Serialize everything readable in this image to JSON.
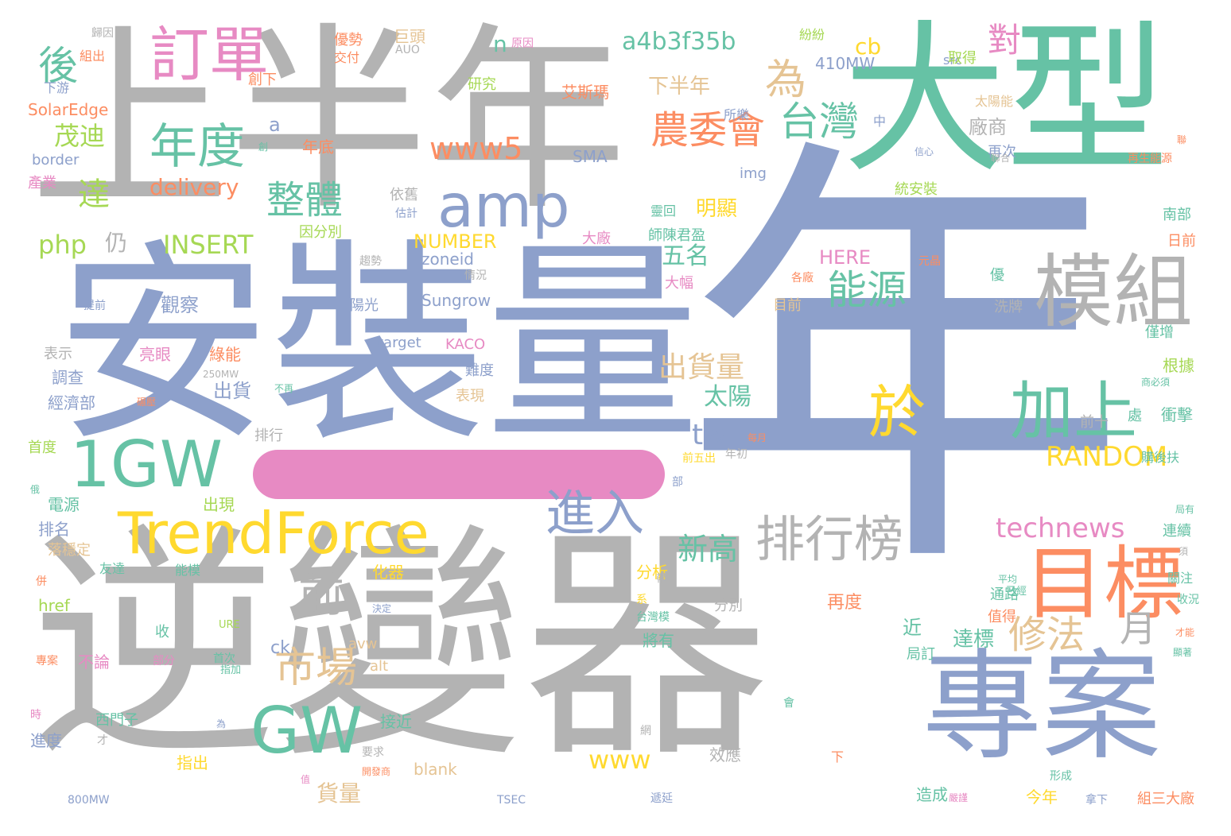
{
  "colors": {
    "gray": "#b3b3b3",
    "blue": "#8da0cb",
    "green": "#66c2a5",
    "pink": "#e78ac3",
    "orange": "#fc8d62",
    "yellow": "#ffd92f",
    "tan": "#e5c494",
    "lime": "#a6d854"
  },
  "bar_color": "#e78ac3",
  "words": [
    {
      "text": "年",
      "color": "blue"
    },
    {
      "text": "逆變器",
      "color": "gray"
    },
    {
      "text": "安裝量",
      "color": "blue"
    },
    {
      "text": "上半年",
      "color": "gray"
    },
    {
      "text": "大型",
      "color": "green"
    },
    {
      "text": "專案",
      "color": "blue"
    },
    {
      "text": "目標",
      "color": "orange"
    },
    {
      "text": "模組",
      "color": "gray"
    },
    {
      "text": "訂單",
      "color": "pink"
    },
    {
      "text": "1GW",
      "color": "green"
    },
    {
      "text": "TrendForce",
      "color": "yellow"
    },
    {
      "text": "amp",
      "color": "blue"
    },
    {
      "text": "加上",
      "color": "green"
    },
    {
      "text": "於",
      "color": "yellow"
    },
    {
      "text": "年度",
      "color": "green"
    },
    {
      "text": "GW",
      "color": "green"
    },
    {
      "text": "排行榜",
      "color": "gray"
    },
    {
      "text": "進入",
      "color": "blue"
    },
    {
      "text": "前",
      "color": "gray"
    },
    {
      "text": "市場",
      "color": "tan"
    },
    {
      "text": "修法",
      "color": "tan"
    },
    {
      "text": "月",
      "color": "gray"
    },
    {
      "text": "能源",
      "color": "green"
    },
    {
      "text": "台灣",
      "color": "green"
    },
    {
      "text": "農委會",
      "color": "orange"
    },
    {
      "text": "整體",
      "color": "green"
    },
    {
      "text": "為",
      "color": "tan"
    },
    {
      "text": "後",
      "color": "green"
    },
    {
      "text": "對",
      "color": "pink"
    },
    {
      "text": "www5",
      "color": "orange"
    },
    {
      "text": "a4b3f35b",
      "color": "green"
    },
    {
      "text": "technews",
      "color": "pink"
    },
    {
      "text": "RANDOM",
      "color": "yellow"
    },
    {
      "text": "出貨量",
      "color": "tan"
    },
    {
      "text": "新高",
      "color": "green"
    },
    {
      "text": "www",
      "color": "yellow"
    },
    {
      "text": "INSERT",
      "color": "lime"
    },
    {
      "text": "php",
      "color": "lime"
    },
    {
      "text": "仍",
      "color": "gray"
    },
    {
      "text": "delivery",
      "color": "orange"
    },
    {
      "text": "達",
      "color": "lime"
    },
    {
      "text": "茂迪",
      "color": "lime"
    },
    {
      "text": "NUMBER",
      "color": "yellow"
    },
    {
      "text": "tw",
      "color": "blue"
    },
    {
      "text": "太陽",
      "color": "green"
    },
    {
      "text": "五名",
      "color": "green"
    },
    {
      "text": "明顯",
      "color": "yellow"
    },
    {
      "text": "下半年",
      "color": "tan"
    },
    {
      "text": "cb",
      "color": "yellow"
    },
    {
      "text": "n",
      "color": "green"
    },
    {
      "text": "a",
      "color": "blue"
    },
    {
      "text": "廠商",
      "color": "gray"
    },
    {
      "text": "出貨",
      "color": "blue"
    },
    {
      "text": "貨量",
      "color": "tan"
    },
    {
      "text": "達標",
      "color": "green"
    },
    {
      "text": "近",
      "color": "green"
    },
    {
      "text": "觀察",
      "color": "blue"
    },
    {
      "text": "HERE",
      "color": "pink"
    },
    {
      "text": "Sungrow",
      "color": "blue"
    },
    {
      "text": "zoneid",
      "color": "blue"
    },
    {
      "text": "410MW",
      "color": "blue"
    },
    {
      "text": "SolarEdge",
      "color": "orange"
    },
    {
      "text": "KACO",
      "color": "pink"
    },
    {
      "text": "target",
      "color": "blue"
    },
    {
      "text": "SMA",
      "color": "blue"
    },
    {
      "text": "href",
      "color": "lime"
    },
    {
      "text": "blank",
      "color": "tan"
    },
    {
      "text": "avw",
      "color": "tan"
    },
    {
      "text": "alt",
      "color": "tan"
    },
    {
      "text": "ck",
      "color": "blue"
    },
    {
      "text": "img",
      "color": "blue"
    },
    {
      "text": "src",
      "color": "blue"
    },
    {
      "text": "border",
      "color": "blue"
    },
    {
      "text": "AUO",
      "color": "gray"
    },
    {
      "text": "TSEC",
      "color": "blue"
    },
    {
      "text": "800MW",
      "color": "blue"
    },
    {
      "text": "250MW",
      "color": "gray"
    },
    {
      "text": "URE",
      "color": "lime"
    },
    {
      "text": "艾斯瑪",
      "color": "orange"
    },
    {
      "text": "研究",
      "color": "lime"
    },
    {
      "text": "年底",
      "color": "orange"
    },
    {
      "text": "創下",
      "color": "orange"
    },
    {
      "text": "所樂",
      "color": "blue"
    },
    {
      "text": "太陽能",
      "color": "tan"
    },
    {
      "text": "取得",
      "color": "lime"
    },
    {
      "text": "再次",
      "color": "blue"
    },
    {
      "text": "依舊",
      "color": "gray"
    },
    {
      "text": "估計",
      "color": "blue"
    },
    {
      "text": "因分別",
      "color": "lime"
    },
    {
      "text": "大廠",
      "color": "pink"
    },
    {
      "text": "師陳君盈",
      "color": "green"
    },
    {
      "text": "大幅",
      "color": "pink"
    },
    {
      "text": "陽光",
      "color": "blue"
    },
    {
      "text": "綠能",
      "color": "orange"
    },
    {
      "text": "亮眼",
      "color": "pink"
    },
    {
      "text": "表示",
      "color": "gray"
    },
    {
      "text": "調查",
      "color": "blue"
    },
    {
      "text": "經濟部",
      "color": "blue"
    },
    {
      "text": "首度",
      "color": "lime"
    },
    {
      "text": "電源",
      "color": "green"
    },
    {
      "text": "排名",
      "color": "blue"
    },
    {
      "text": "落穩定",
      "color": "tan"
    },
    {
      "text": "能模",
      "color": "green"
    },
    {
      "text": "友達",
      "color": "green"
    },
    {
      "text": "出現",
      "color": "lime"
    },
    {
      "text": "化器",
      "color": "yellow"
    },
    {
      "text": "分析",
      "color": "yellow"
    },
    {
      "text": "收",
      "color": "green"
    },
    {
      "text": "不論",
      "color": "pink"
    },
    {
      "text": "西門子",
      "color": "green"
    },
    {
      "text": "接近",
      "color": "green"
    },
    {
      "text": "效應",
      "color": "gray"
    },
    {
      "text": "指出",
      "color": "yellow"
    },
    {
      "text": "進度",
      "color": "blue"
    },
    {
      "text": "分別",
      "color": "gray"
    },
    {
      "text": "再度",
      "color": "orange"
    },
    {
      "text": "通路",
      "color": "green"
    },
    {
      "text": "值得",
      "color": "orange"
    },
    {
      "text": "局訂",
      "color": "green"
    },
    {
      "text": "將有",
      "color": "green"
    },
    {
      "text": "今年",
      "color": "yellow"
    },
    {
      "text": "造成",
      "color": "green"
    },
    {
      "text": "組三大廠",
      "color": "orange"
    },
    {
      "text": "根據",
      "color": "lime"
    },
    {
      "text": "衝擊",
      "color": "green"
    },
    {
      "text": "南部",
      "color": "green"
    },
    {
      "text": "日前",
      "color": "orange"
    },
    {
      "text": "洗牌",
      "color": "gray"
    },
    {
      "text": "僅增",
      "color": "green"
    },
    {
      "text": "連續",
      "color": "green"
    },
    {
      "text": "關注",
      "color": "green"
    },
    {
      "text": "統安裝",
      "color": "lime"
    },
    {
      "text": "目前",
      "color": "tan"
    },
    {
      "text": "難度",
      "color": "blue"
    },
    {
      "text": "表現",
      "color": "tan"
    },
    {
      "text": "排行",
      "color": "gray"
    },
    {
      "text": "年初",
      "color": "gray"
    },
    {
      "text": "購後扶",
      "color": "green"
    },
    {
      "text": "前十",
      "color": "gray"
    },
    {
      "text": "下游",
      "color": "blue"
    },
    {
      "text": "組出",
      "color": "orange"
    },
    {
      "text": "歸因",
      "color": "gray"
    },
    {
      "text": "優勢",
      "color": "orange"
    },
    {
      "text": "交付",
      "color": "orange"
    },
    {
      "text": "巨頭",
      "color": "tan"
    },
    {
      "text": "原因",
      "color": "pink"
    },
    {
      "text": "紛紛",
      "color": "lime"
    },
    {
      "text": "產業",
      "color": "pink"
    },
    {
      "text": "提前",
      "color": "blue"
    },
    {
      "text": "情況",
      "color": "gray"
    },
    {
      "text": "趨勢",
      "color": "gray"
    },
    {
      "text": "元晶",
      "color": "orange"
    },
    {
      "text": "各廠",
      "color": "orange"
    },
    {
      "text": "優",
      "color": "green"
    },
    {
      "text": "處",
      "color": "green"
    },
    {
      "text": "中",
      "color": "blue"
    },
    {
      "text": "信心",
      "color": "blue"
    },
    {
      "text": "聯合",
      "color": "gray"
    },
    {
      "text": "再生能源",
      "color": "orange"
    },
    {
      "text": "靈回",
      "color": "green"
    },
    {
      "text": "每月",
      "color": "orange"
    },
    {
      "text": "前五出",
      "color": "yellow"
    },
    {
      "text": "台灣模",
      "color": "green"
    },
    {
      "text": "系",
      "color": "yellow"
    },
    {
      "text": "才能",
      "color": "orange"
    },
    {
      "text": "遞延",
      "color": "blue"
    },
    {
      "text": "形成",
      "color": "green"
    },
    {
      "text": "拿下",
      "color": "blue"
    },
    {
      "text": "開發商",
      "color": "orange"
    },
    {
      "text": "要求",
      "color": "gray"
    },
    {
      "text": "首次",
      "color": "green"
    },
    {
      "text": "部分",
      "color": "pink"
    },
    {
      "text": "專案",
      "color": "orange"
    },
    {
      "text": "已經",
      "color": "green"
    },
    {
      "text": "收況",
      "color": "green"
    },
    {
      "text": "平均",
      "color": "green"
    },
    {
      "text": "商必須",
      "color": "green"
    },
    {
      "text": "下",
      "color": "orange"
    },
    {
      "text": "網",
      "color": "gray"
    },
    {
      "text": "會",
      "color": "green"
    },
    {
      "text": "為",
      "color": "blue"
    },
    {
      "text": "俄",
      "color": "green"
    },
    {
      "text": "時",
      "color": "pink"
    },
    {
      "text": "帶",
      "color": "gray"
    },
    {
      "text": "併",
      "color": "orange"
    },
    {
      "text": "顯著",
      "color": "green"
    },
    {
      "text": "局有",
      "color": "green"
    },
    {
      "text": "須",
      "color": "gray"
    },
    {
      "text": "創",
      "color": "green"
    },
    {
      "text": "聯",
      "color": "orange"
    },
    {
      "text": "不再",
      "color": "green"
    },
    {
      "text": "指加",
      "color": "green"
    },
    {
      "text": "才",
      "color": "gray"
    },
    {
      "text": "碾壓",
      "color": "orange"
    },
    {
      "text": "決定",
      "color": "blue"
    },
    {
      "text": "部",
      "color": "blue"
    },
    {
      "text": "嚴謹",
      "color": "pink"
    },
    {
      "text": "值",
      "color": "pink"
    }
  ]
}
